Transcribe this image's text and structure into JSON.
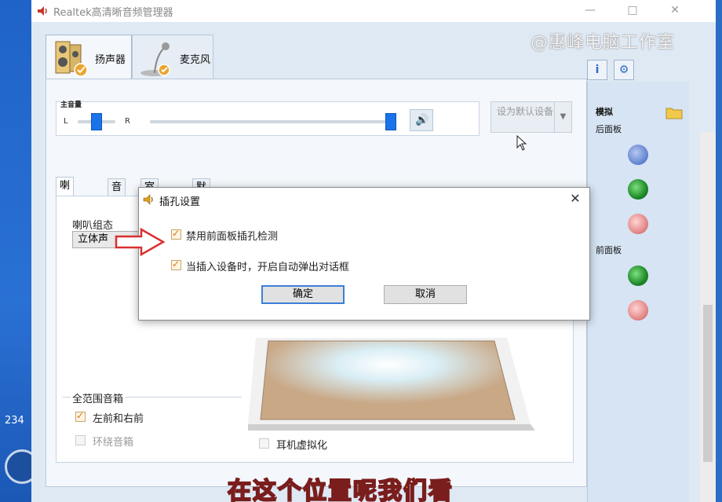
{
  "window": {
    "title": "Realtek高清晰音频管理器",
    "minimize": "—",
    "maximize": "□",
    "close": "✕"
  },
  "watermark": "@惠峰电脑工作室",
  "device_tabs": [
    {
      "label": "扬声器"
    },
    {
      "label": "麦克风"
    }
  ],
  "volume": {
    "title": "主音量",
    "left": "L",
    "right": "R",
    "balance_fraction": 0.5,
    "level_fraction": 1.0
  },
  "default_device": {
    "label": "设为默认设备"
  },
  "sub_tabs": [
    "喇叭组态",
    "音效",
    "室内校正",
    "默认格式"
  ],
  "speaker_config": {
    "label": "喇叭组态",
    "selected": "立体声"
  },
  "fullrange": {
    "title": "全范围音箱",
    "front": "左前和右前",
    "surround": "环绕音箱"
  },
  "headphone_virtualization": "耳机虚拟化",
  "jacks": {
    "analog": "模拟",
    "back_panel": "后面板",
    "front_panel": "前面板"
  },
  "dialog": {
    "title": "插孔设置",
    "option1": "禁用前面板插孔检测",
    "option2": "当插入设备时，开启自动弹出对话框",
    "ok": "确定",
    "cancel": "取消"
  },
  "caption": "在这个位置呢我们看",
  "desktop": {
    "num": "234"
  },
  "colors": {
    "accent": "#1a73e8",
    "check": "#d5751d",
    "arrow": "#d93030",
    "caption": "#f7d21b"
  }
}
